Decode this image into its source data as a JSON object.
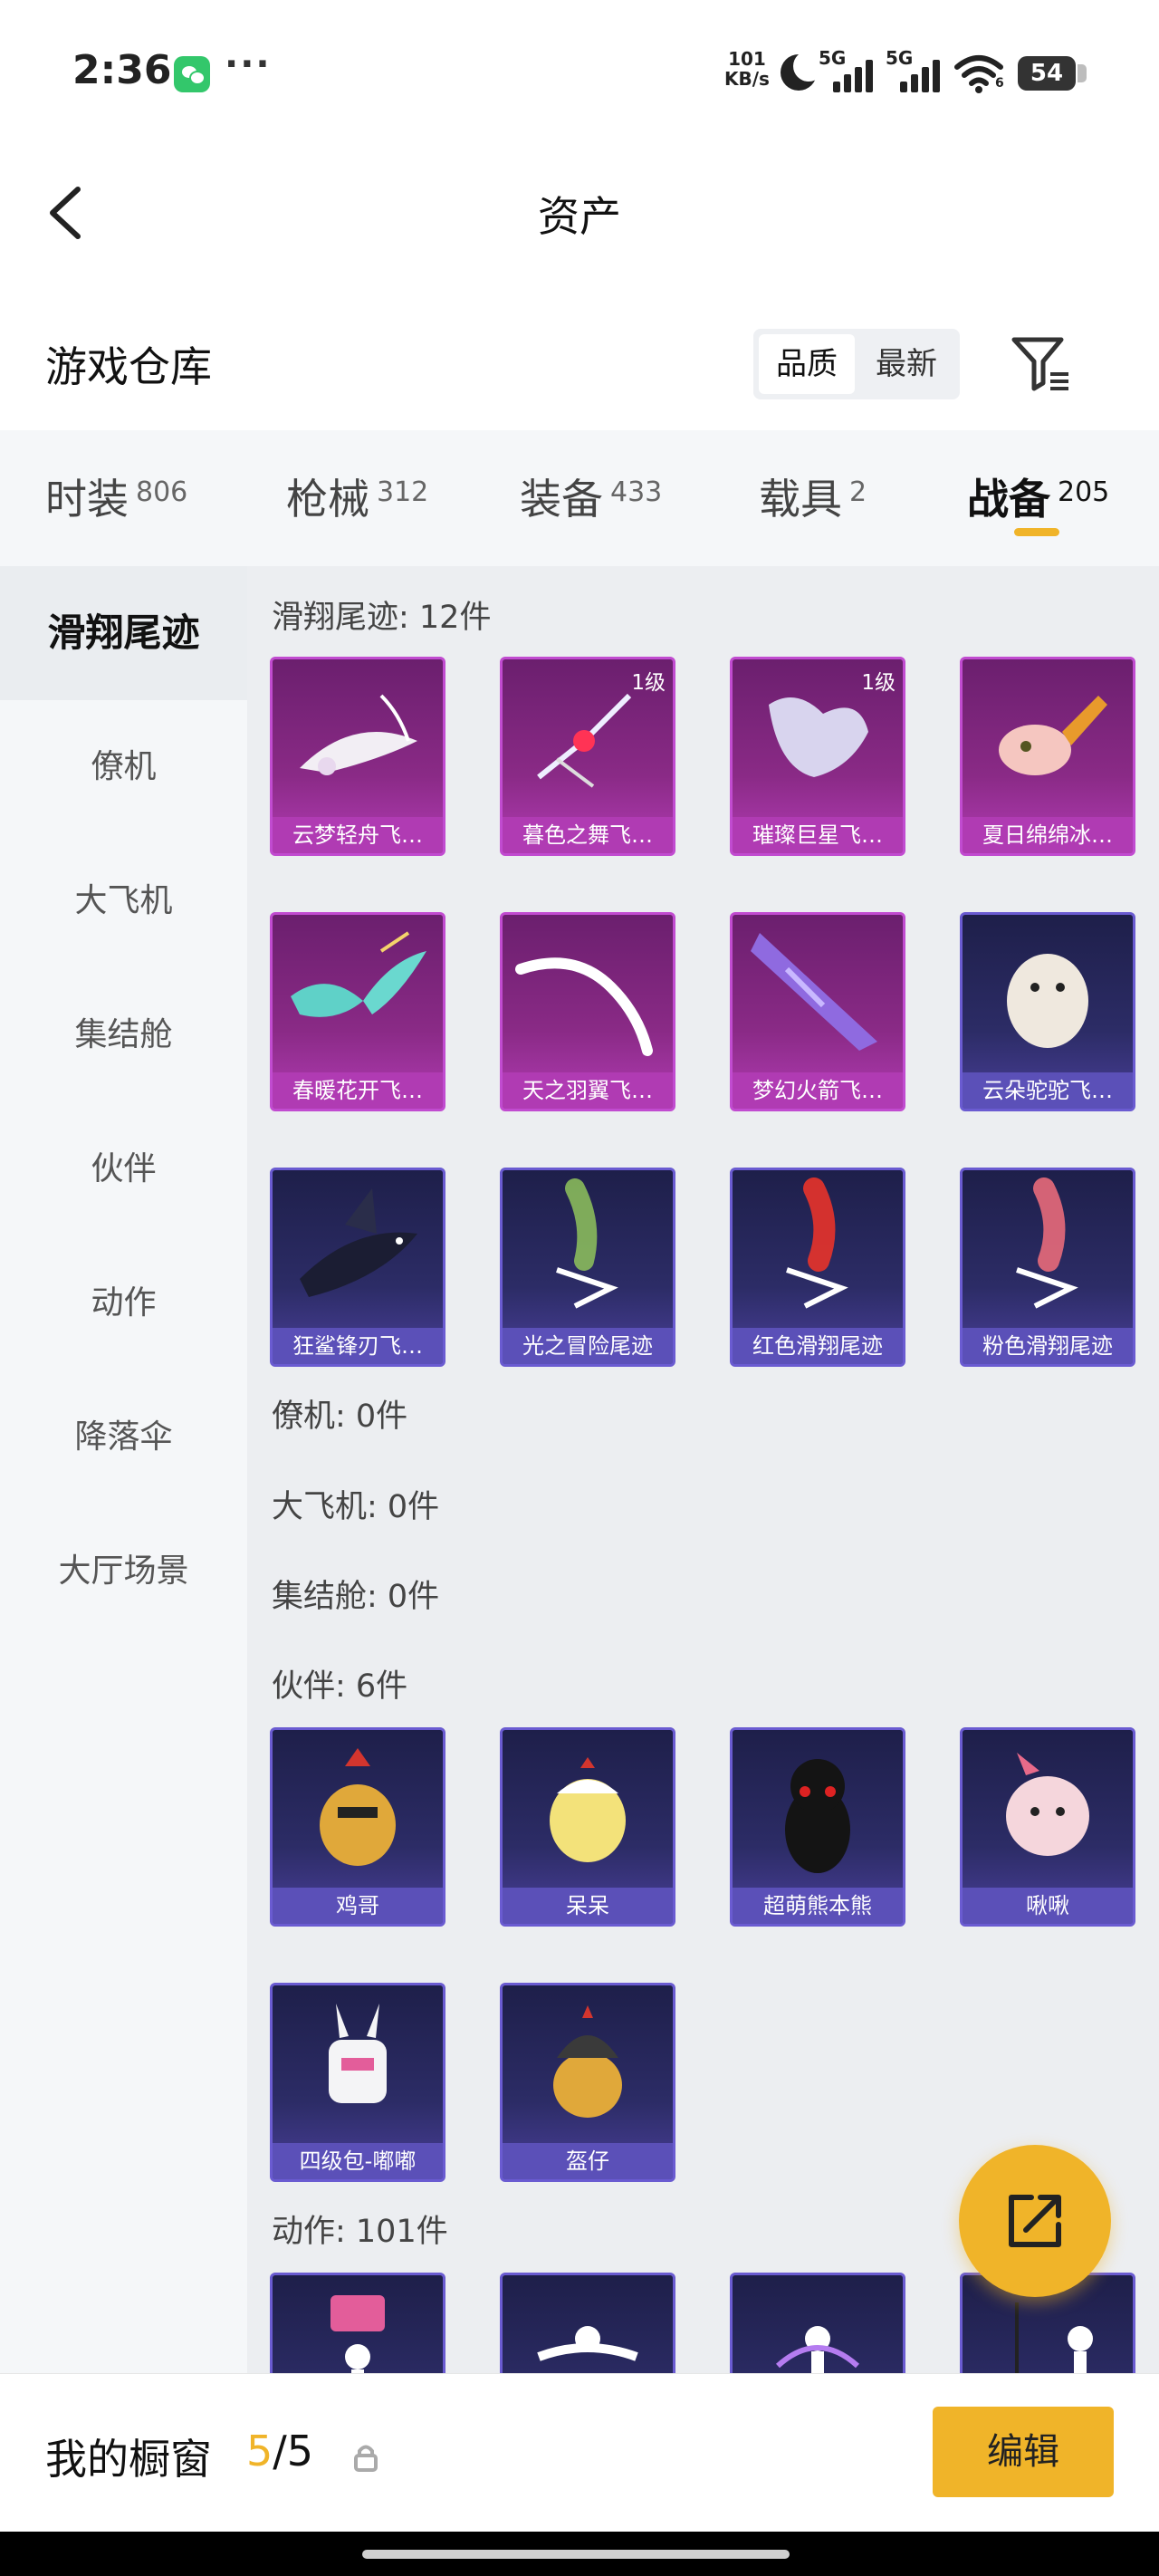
{
  "status_bar": {
    "time": "2:36",
    "dots": "···",
    "speed_value": "101",
    "speed_unit": "KB/s",
    "signal1": "5G",
    "signal2": "5G",
    "wifi_sub": "6",
    "battery": "54",
    "icons": [
      "wechat-icon",
      "moon-icon",
      "signal-icon",
      "wifi-icon",
      "battery-icon"
    ]
  },
  "nav": {
    "title": "资产",
    "back_icon": "chevron-left-icon"
  },
  "warehouse": {
    "title": "游戏仓库",
    "sort_options": [
      "品质",
      "最新"
    ],
    "sort_selected": "品质",
    "filter_icon": "filter-icon"
  },
  "category_tabs": [
    {
      "name": "时装",
      "count": "806"
    },
    {
      "name": "枪械",
      "count": "312"
    },
    {
      "name": "装备",
      "count": "433"
    },
    {
      "name": "载具",
      "count": "2"
    },
    {
      "name": "战备",
      "count": "205",
      "active": true
    }
  ],
  "sidebar": {
    "items": [
      "滑翔尾迹",
      "僚机",
      "大飞机",
      "集结舱",
      "伙伴",
      "动作",
      "降落伞",
      "大厅场景"
    ],
    "active": "滑翔尾迹"
  },
  "sections": {
    "glide": {
      "header": "滑翔尾迹: 12件",
      "items": [
        {
          "name": "云梦轻舟飞…",
          "level": "",
          "rarity": "purple"
        },
        {
          "name": "暮色之舞飞…",
          "level": "1级",
          "rarity": "purple"
        },
        {
          "name": "璀璨巨星飞…",
          "level": "1级",
          "rarity": "purple"
        },
        {
          "name": "夏日绵绵冰…",
          "level": "",
          "rarity": "purple"
        },
        {
          "name": "春暖花开飞…",
          "level": "",
          "rarity": "purple"
        },
        {
          "name": "天之羽翼飞…",
          "level": "",
          "rarity": "purple"
        },
        {
          "name": "梦幻火箭飞…",
          "level": "",
          "rarity": "purple"
        },
        {
          "name": "云朵驼驼飞…",
          "level": "",
          "rarity": "blue"
        },
        {
          "name": "狂鲨锋刃飞…",
          "level": "",
          "rarity": "blue"
        },
        {
          "name": "光之冒险尾迹",
          "level": "",
          "rarity": "blue"
        },
        {
          "name": "红色滑翔尾迹",
          "level": "",
          "rarity": "blue"
        },
        {
          "name": "粉色滑翔尾迹",
          "level": "",
          "rarity": "blue"
        }
      ]
    },
    "wingman": {
      "header": "僚机: 0件"
    },
    "plane": {
      "header": "大飞机: 0件"
    },
    "capsule": {
      "header": "集结舱: 0件"
    },
    "partner": {
      "header": "伙伴: 6件",
      "items": [
        {
          "name": "鸡哥",
          "rarity": "blue"
        },
        {
          "name": "呆呆",
          "rarity": "blue"
        },
        {
          "name": "超萌熊本熊",
          "rarity": "blue"
        },
        {
          "name": "啾啾",
          "rarity": "blue"
        },
        {
          "name": "四级包-嘟嘟",
          "rarity": "blue"
        },
        {
          "name": "盔仔",
          "rarity": "blue"
        }
      ]
    },
    "emote": {
      "header": "动作: 101件"
    }
  },
  "bottom_bar": {
    "title": "我的橱窗",
    "current": "5",
    "separator": "/",
    "total": "5",
    "edit_label": "编辑"
  },
  "colors": {
    "accent": "#f0b429",
    "purple_rarity": "#b03bb3",
    "blue_rarity": "#5b50b8"
  }
}
